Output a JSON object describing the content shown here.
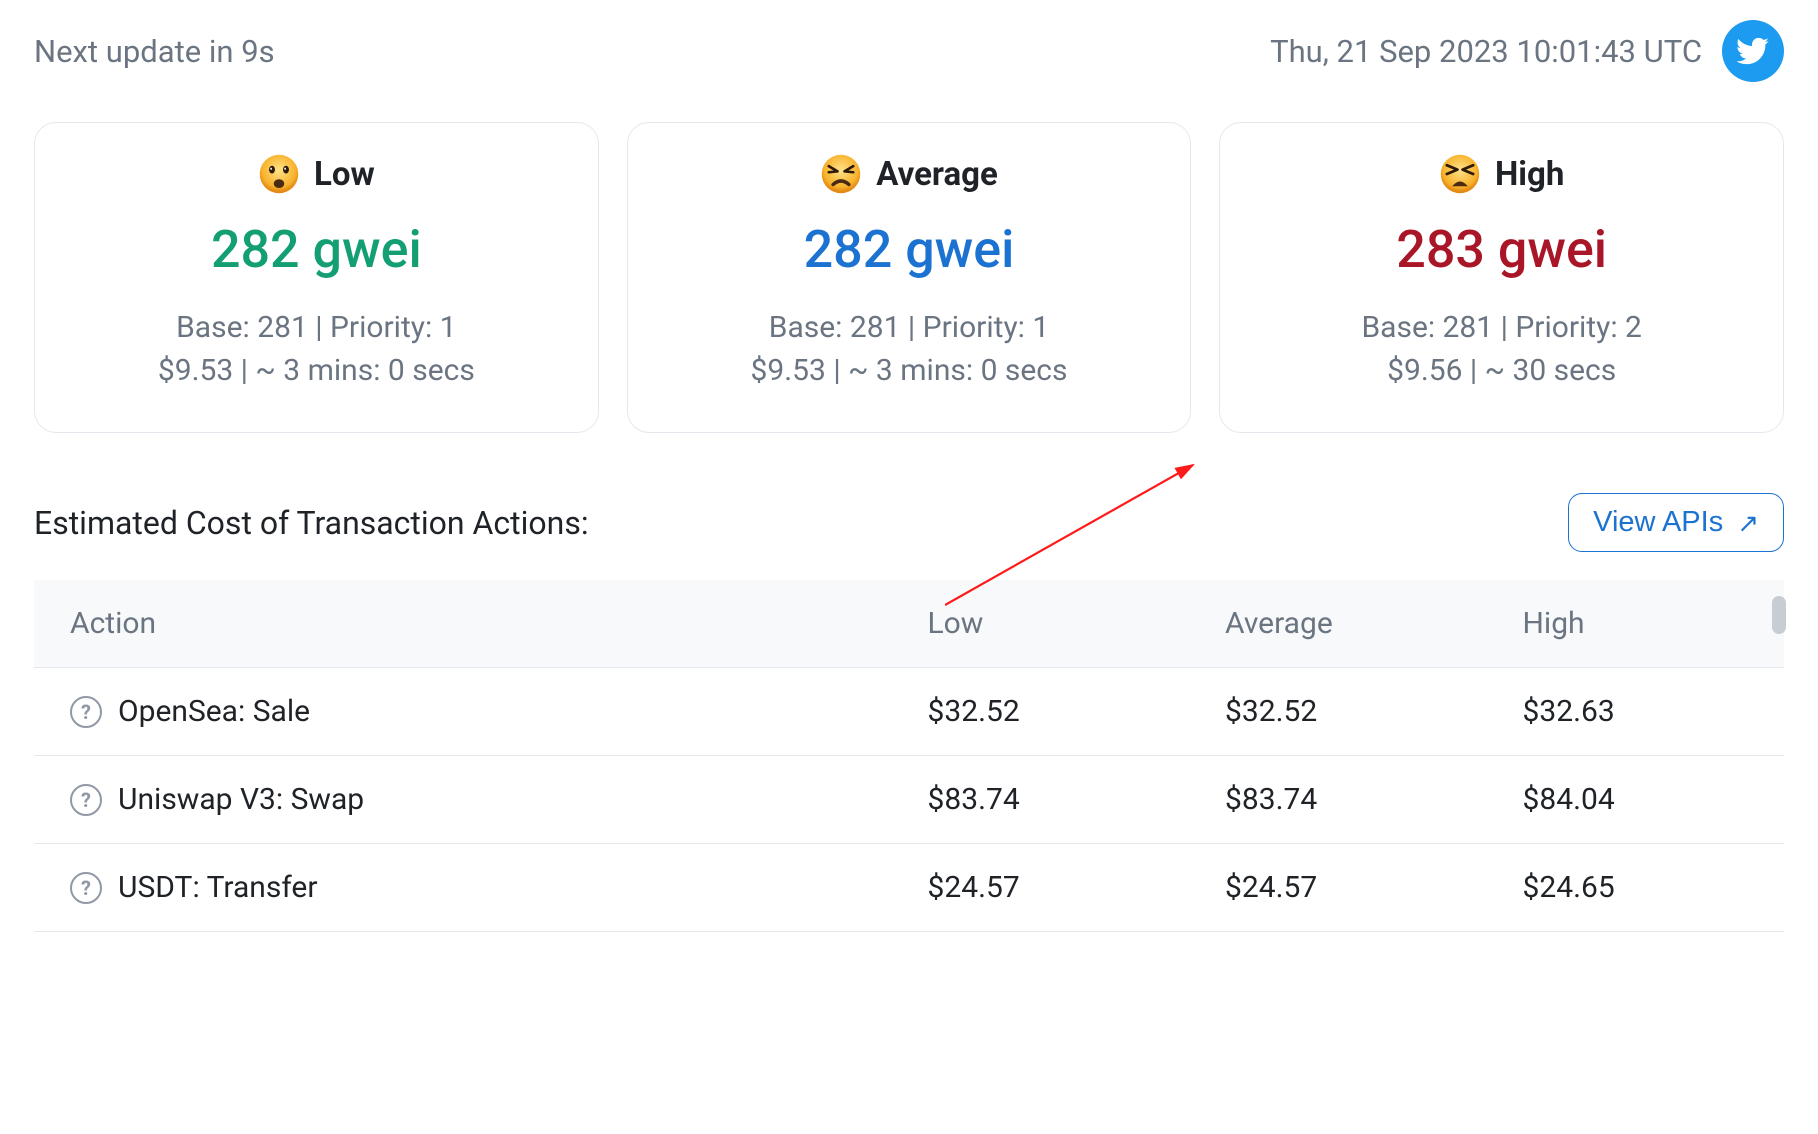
{
  "topbar": {
    "next_update": "Next update in 9s",
    "timestamp": "Thu, 21 Sep 2023 10:01:43 UTC"
  },
  "cards": {
    "low": {
      "label": "Low",
      "gwei": "282 gwei",
      "base_priority": "Base: 281 | Priority: 1",
      "cost_time": "$9.53 | ~ 3 mins: 0 secs"
    },
    "average": {
      "label": "Average",
      "gwei": "282 gwei",
      "base_priority": "Base: 281 | Priority: 1",
      "cost_time": "$9.53 | ~ 3 mins: 0 secs"
    },
    "high": {
      "label": "High",
      "gwei": "283 gwei",
      "base_priority": "Base: 281 | Priority: 2",
      "cost_time": "$9.56 | ~ 30 secs"
    }
  },
  "section": {
    "title": "Estimated Cost of Transaction Actions:",
    "view_apis": "View APIs"
  },
  "table": {
    "headers": {
      "action": "Action",
      "low": "Low",
      "avg": "Average",
      "high": "High"
    },
    "rows": [
      {
        "action": "OpenSea: Sale",
        "low": "$32.52",
        "avg": "$32.52",
        "high": "$32.63"
      },
      {
        "action": "Uniswap V3: Swap",
        "low": "$83.74",
        "avg": "$83.74",
        "high": "$84.04"
      },
      {
        "action": "USDT: Transfer",
        "low": "$24.57",
        "avg": "$24.57",
        "high": "$24.65"
      }
    ]
  }
}
